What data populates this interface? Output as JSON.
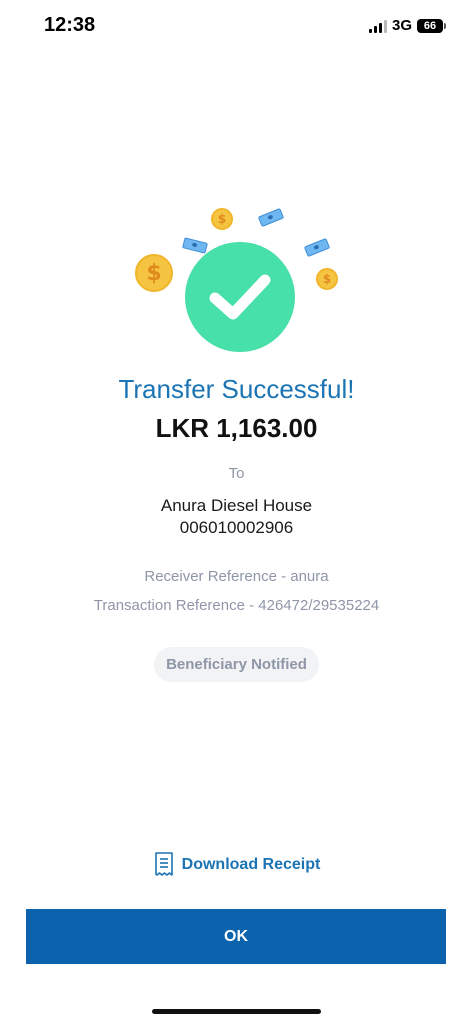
{
  "status_bar": {
    "time": "12:38",
    "network": "3G",
    "battery": "66"
  },
  "icons": {
    "success": "checkmark-icon",
    "coins": "dollar-coin-icon",
    "bills": "banknote-icon",
    "receipt": "receipt-icon"
  },
  "colors": {
    "accent": "#1b74b3",
    "success_green": "#47e0a8",
    "primary_button": "#0b63ad",
    "muted_text": "#8f96a8"
  },
  "result": {
    "title": "Transfer Successful!",
    "amount": "LKR 1,163.00",
    "to_label": "To",
    "recipient_name": "Anura Diesel House",
    "recipient_account": "006010002906",
    "receiver_reference": "Receiver Reference - anura",
    "transaction_reference": "Transaction Reference - 426472/29535224",
    "notification_badge": "Beneficiary Notified",
    "coin_symbol": "$"
  },
  "actions": {
    "download_receipt": "Download Receipt",
    "ok": "OK"
  }
}
